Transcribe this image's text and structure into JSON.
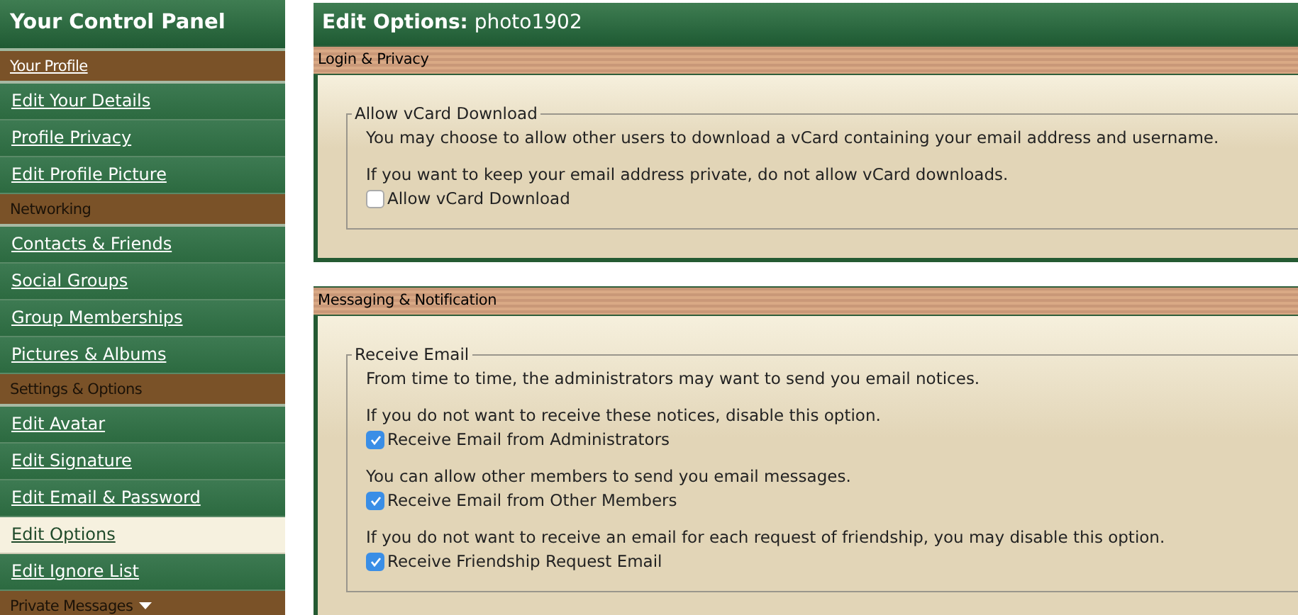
{
  "sidebar": {
    "title": "Your Control Panel",
    "sections": [
      {
        "title": "Your Profile",
        "linked": true,
        "collapsible": false,
        "items": [
          {
            "label": "Edit Your Details",
            "selected": false
          },
          {
            "label": "Profile Privacy",
            "selected": false
          },
          {
            "label": "Edit Profile Picture",
            "selected": false
          }
        ]
      },
      {
        "title": "Networking",
        "linked": false,
        "collapsible": false,
        "items": [
          {
            "label": "Contacts & Friends",
            "selected": false
          },
          {
            "label": "Social Groups",
            "selected": false
          },
          {
            "label": "Group Memberships",
            "selected": false
          },
          {
            "label": "Pictures & Albums",
            "selected": false
          }
        ]
      },
      {
        "title": "Settings & Options",
        "linked": false,
        "collapsible": false,
        "items": [
          {
            "label": "Edit Avatar",
            "selected": false
          },
          {
            "label": "Edit Signature",
            "selected": false
          },
          {
            "label": "Edit Email & Password",
            "selected": false
          },
          {
            "label": "Edit Options",
            "selected": true
          },
          {
            "label": "Edit Ignore List",
            "selected": false
          }
        ]
      },
      {
        "title": "Private Messages",
        "linked": false,
        "collapsible": true
      }
    ]
  },
  "main": {
    "title": "**Edit Options:** photo1902",
    "panels": [
      {
        "header": "Login & Privacy",
        "fieldsets": [
          {
            "legend": "Allow vCard Download",
            "items": [
              {
                "kind": "text",
                "text": "You may choose to allow other users to download a vCard containing your email address and username."
              },
              {
                "kind": "text",
                "text": "If you want to keep your email address private, do not allow vCard downloads."
              },
              {
                "kind": "checkbox",
                "label": "Allow vCard Download",
                "checked": false
              }
            ]
          }
        ]
      },
      {
        "header": "Messaging & Notification",
        "fieldsets": [
          {
            "legend": "Receive Email",
            "items": [
              {
                "kind": "text",
                "text": "From time to time, the administrators may want to send you email notices."
              },
              {
                "kind": "text",
                "text": "If you do not want to receive these notices, disable this option."
              },
              {
                "kind": "checkbox",
                "label": "Receive Email from Administrators",
                "checked": true
              },
              {
                "kind": "text",
                "text": "You can allow other members to send you email messages."
              },
              {
                "kind": "checkbox",
                "label": "Receive Email from Other Members",
                "checked": true
              },
              {
                "kind": "text",
                "text": "If you do not want to receive an email for each request of friendship, you may disable this option."
              },
              {
                "kind": "checkbox",
                "label": "Receive Friendship Request Email",
                "checked": true
              }
            ]
          }
        ]
      }
    ]
  }
}
